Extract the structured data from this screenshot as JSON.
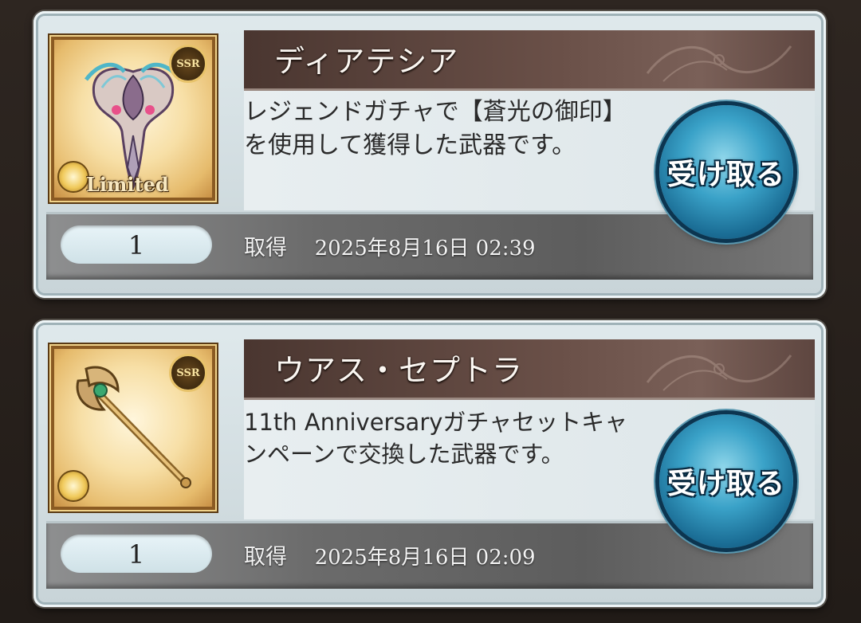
{
  "items": [
    {
      "name": "ディアテシア",
      "rarity_badge": "SSR",
      "tag": "Limited",
      "description": "レジェンドガチャで【蒼光の御印】を使用して獲得した武器です。",
      "count": "1",
      "acquired_label": "取得",
      "acquired_date": "2025年8月16日 02:39",
      "button_label": "受け取る",
      "icon": "crest-weapon-icon"
    },
    {
      "name": "ウアス・セプトラ",
      "rarity_badge": "SSR",
      "description": "11th Anniversaryガチャセットキャンペーンで交換した武器です。",
      "count": "1",
      "acquired_label": "取得",
      "acquired_date": "2025年8月16日 02:09",
      "button_label": "受け取る",
      "icon": "scepter-weapon-icon"
    }
  ],
  "colors": {
    "title_bar": "#5a423a",
    "button": "#3aa2c8",
    "frame": "#c8d4d8"
  }
}
